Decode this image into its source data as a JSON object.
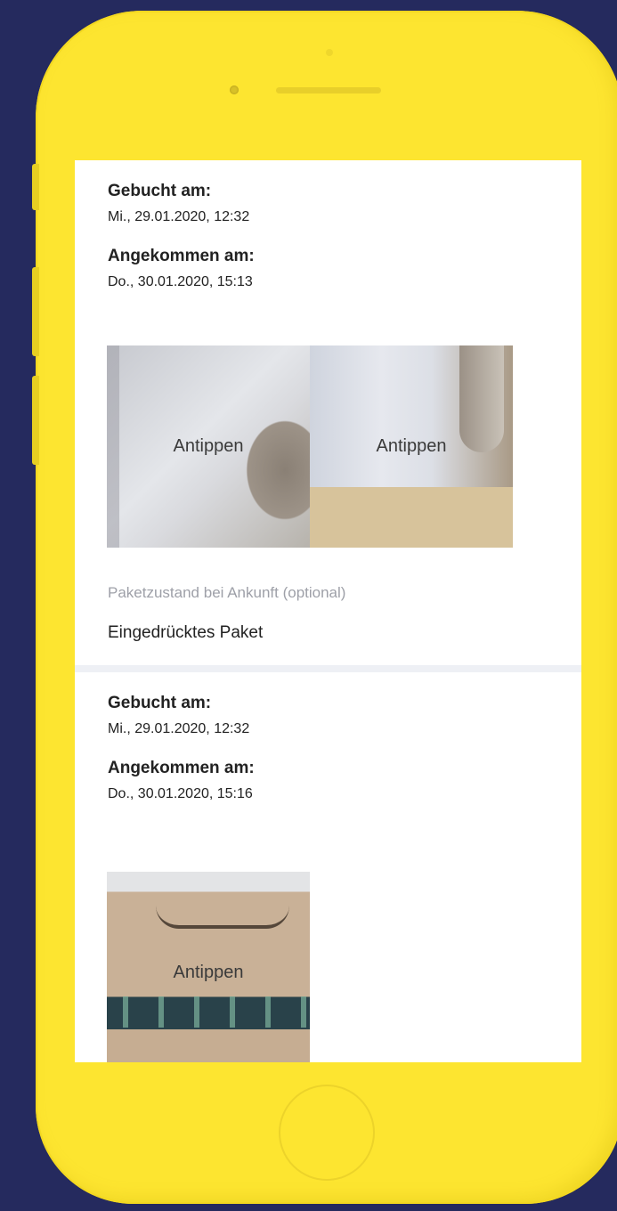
{
  "theme": {
    "background": "#252a5e",
    "phone": "#fde530",
    "screen": "#ffffff"
  },
  "parcels": [
    {
      "booked_label": "Gebucht am:",
      "booked_value": "Mi., 29.01.2020, 12:32",
      "arrived_label": "Angekommen am:",
      "arrived_value": "Do., 30.01.2020, 15:13",
      "photos": [
        "Antippen",
        "Antippen"
      ],
      "condition_label": "Paketzustand bei Ankunft (optional)",
      "condition_value": "Eingedrücktes Paket"
    },
    {
      "booked_label": "Gebucht am:",
      "booked_value": "Mi., 29.01.2020, 12:32",
      "arrived_label": "Angekommen am:",
      "arrived_value": "Do., 30.01.2020, 15:16",
      "photos": [
        "Antippen"
      ]
    }
  ]
}
